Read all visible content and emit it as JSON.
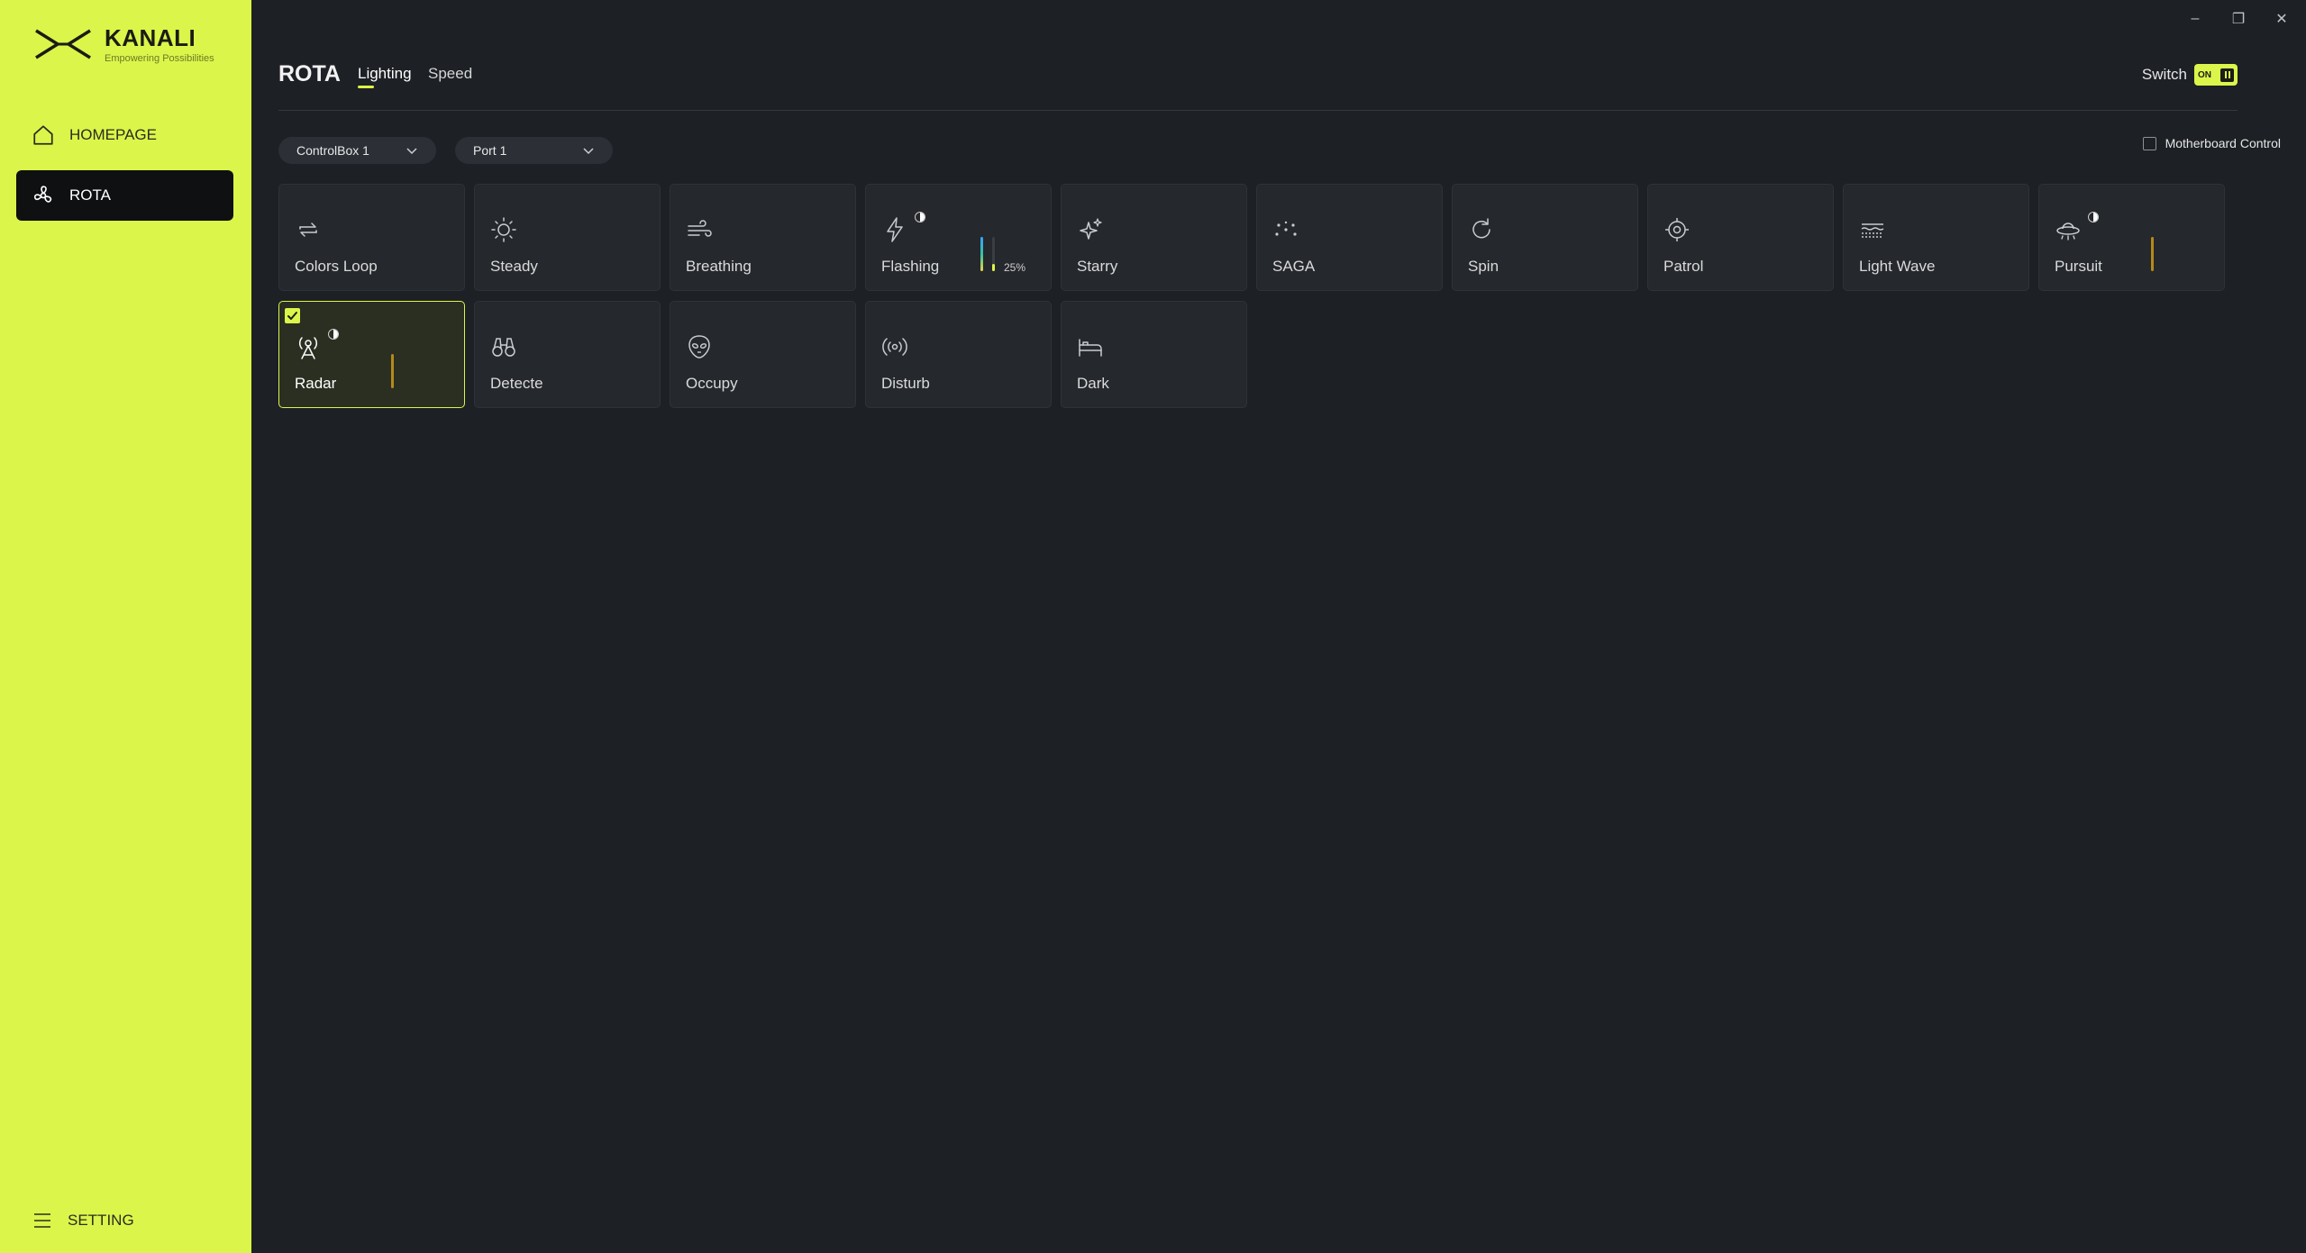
{
  "brand": {
    "name": "KANALI",
    "tagline": "Empowering Possibilities"
  },
  "sidebar": {
    "items": [
      {
        "label": "HOMEPAGE",
        "icon": "home-icon"
      },
      {
        "label": "ROTA",
        "icon": "fan-icon",
        "active": true
      }
    ],
    "setting_label": "SETTING"
  },
  "window_controls": {
    "minimize": "–",
    "restore": "❐",
    "close": "✕"
  },
  "header": {
    "title": "ROTA",
    "tabs": [
      {
        "label": "Lighting",
        "active": true
      },
      {
        "label": "Speed"
      }
    ],
    "switch_label": "Switch",
    "switch_state": "ON"
  },
  "selectors": {
    "controlbox": "ControlBox 1",
    "port": "Port 1",
    "motherboard_control": "Motherboard Control"
  },
  "modes": [
    {
      "label": "Colors Loop",
      "icon": "loop-icon"
    },
    {
      "label": "Steady",
      "icon": "sun-icon"
    },
    {
      "label": "Breathing",
      "icon": "wind-icon"
    },
    {
      "label": "Flashing",
      "icon": "lightning-icon",
      "speed_percent": "25%"
    },
    {
      "label": "Starry",
      "icon": "sparkle-icon"
    },
    {
      "label": "SAGA",
      "icon": "dots-icon"
    },
    {
      "label": "Spin",
      "icon": "rotate-icon"
    },
    {
      "label": "Patrol",
      "icon": "target-icon"
    },
    {
      "label": "Light Wave",
      "icon": "wave-icon"
    },
    {
      "label": "Pursuit",
      "icon": "ufo-icon"
    },
    {
      "label": "Radar",
      "icon": "radar-icon",
      "selected": true
    },
    {
      "label": "Detecte",
      "icon": "binoculars-icon"
    },
    {
      "label": "Occupy",
      "icon": "alien-icon"
    },
    {
      "label": "Disturb",
      "icon": "broadcast-icon"
    },
    {
      "label": "Dark",
      "icon": "bed-icon"
    }
  ],
  "colors": {
    "accent": "#dcf54a",
    "background": "#1d2025",
    "card": "#25282d",
    "amber_bar": "#b58a1a"
  }
}
